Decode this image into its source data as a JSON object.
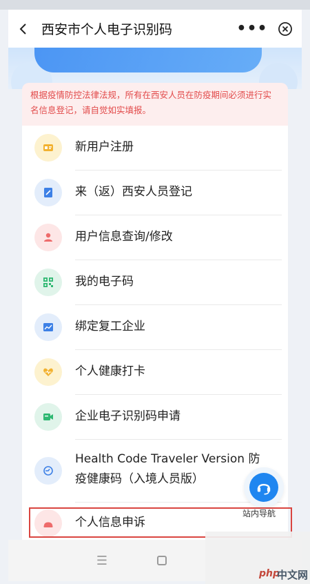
{
  "header": {
    "title": "西安市个人电子识别码",
    "more_label": "•••"
  },
  "notice": {
    "text": "根据疫情防控法律法规，所有在西安人员在防疫期间必须进行实名信息登记，请自觉如实填报。"
  },
  "menu": {
    "items": [
      {
        "label": "新用户注册",
        "icon": "id-card-icon",
        "bg": "#fdf2cf",
        "color": "#f2b230"
      },
      {
        "label": "来（返）西安人员登记",
        "icon": "edit-form-icon",
        "bg": "#e3edfb",
        "color": "#3d80e6"
      },
      {
        "label": "用户信息查询/修改",
        "icon": "user-icon",
        "bg": "#fde6e6",
        "color": "#ee6b6b"
      },
      {
        "label": "我的电子码",
        "icon": "qr-code-icon",
        "bg": "#e0f4ea",
        "color": "#2fb872"
      },
      {
        "label": "绑定复工企业",
        "icon": "chart-icon",
        "bg": "#e3edfb",
        "color": "#3d80e6"
      },
      {
        "label": "个人健康打卡",
        "icon": "heart-icon",
        "bg": "#fdf2cf",
        "color": "#f2b230"
      },
      {
        "label": "企业电子识别码申请",
        "icon": "video-icon",
        "bg": "#e0f4ea",
        "color": "#2fb872"
      },
      {
        "label_line1": "Health Code Traveler Version 防",
        "label_line2": "疫健康码（入境人员版）",
        "icon": "sync-icon",
        "bg": "#e3edfb",
        "color": "#3d80e6"
      },
      {
        "label": "个人信息申诉",
        "icon": "appeal-icon",
        "bg": "#fde6e6",
        "color": "#ee6b6b"
      }
    ]
  },
  "fab": {
    "label": "站内导航",
    "icon": "headset-icon",
    "color": "#1f86f0"
  },
  "watermark": {
    "brand": "php",
    "text": "中文网"
  },
  "colors": {
    "notice_text": "#e24b4b",
    "highlight_border": "#d9443f"
  }
}
